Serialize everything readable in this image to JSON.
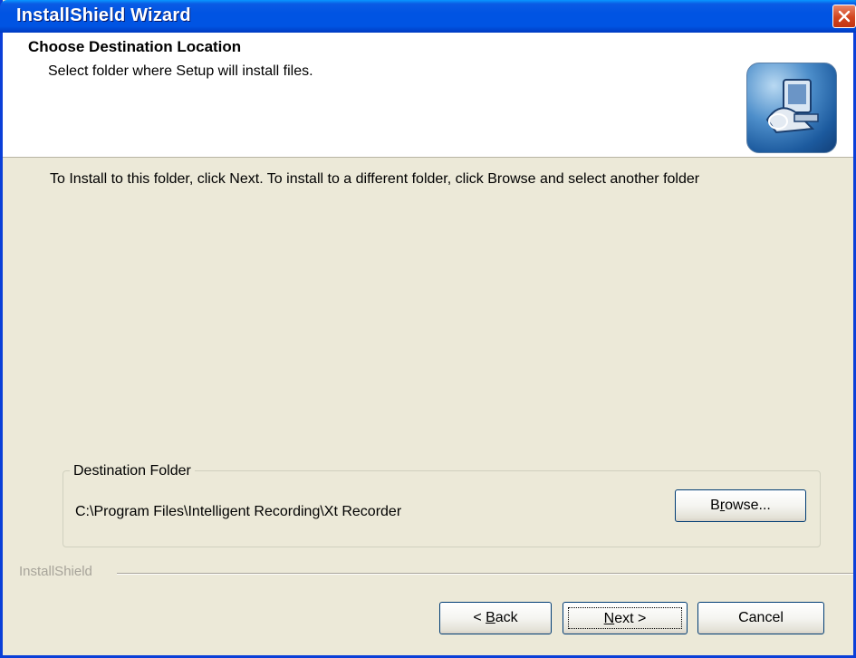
{
  "window": {
    "title": "InstallShield Wizard"
  },
  "header": {
    "title": "Choose Destination Location",
    "subtitle": "Select folder where Setup will install files.",
    "logo_icon": "installer-computer-icon"
  },
  "body": {
    "instructions": "To Install to this folder, click Next. To install to a different folder, click Browse and select another folder"
  },
  "destination": {
    "legend": "Destination Folder",
    "path": "C:\\Program Files\\Intelligent Recording\\Xt Recorder",
    "browse_pre": "B",
    "browse_mnemonic": "r",
    "browse_post": "owse..."
  },
  "brand": {
    "label": "InstallShield"
  },
  "buttons": {
    "back_prefix": "< ",
    "back_mnemonic": "B",
    "back_rest": "ack",
    "next_mnemonic": "N",
    "next_rest": "ext >",
    "cancel": "Cancel"
  },
  "colors": {
    "titlebar": "#0054e3",
    "face": "#ece9d8",
    "close": "#d2451e"
  }
}
